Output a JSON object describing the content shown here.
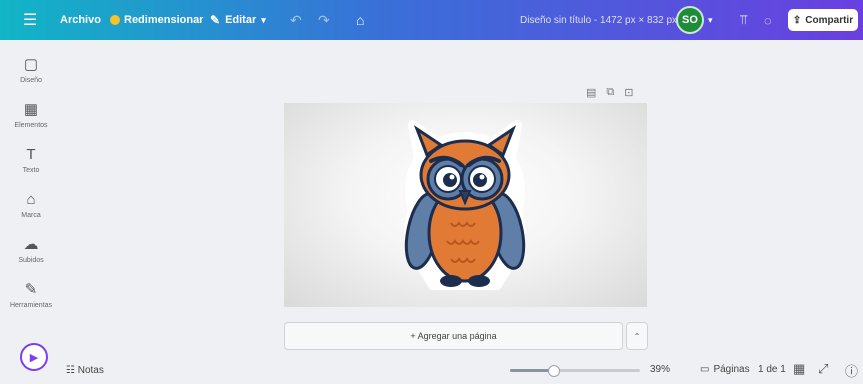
{
  "topbar": {
    "menu_icon": "menu-icon",
    "archivo": "Archivo",
    "redimensionar": "Redimensionar",
    "editar": "Editar",
    "doc_title": "Diseño sin título - 1472 px × 832 px",
    "avatar_initials": "SO",
    "share_label": "Compartir"
  },
  "sidebar": {
    "items": [
      {
        "label": "Diseño",
        "icon": "layout-icon"
      },
      {
        "label": "Elementos",
        "icon": "elements-icon"
      },
      {
        "label": "Texto",
        "icon": "text-icon"
      },
      {
        "label": "Marca",
        "icon": "brand-icon"
      },
      {
        "label": "Subidos",
        "icon": "upload-icon"
      },
      {
        "label": "Herramientas",
        "icon": "tools-icon"
      }
    ]
  },
  "canvas": {
    "add_page_label": "+ Agregar una página"
  },
  "bottombar": {
    "notes_label": "Notas",
    "zoom": "39%",
    "zoom_fraction": 0.33,
    "pages_label": "Páginas",
    "page_count": "1 de 1"
  },
  "colors": {
    "accent": "#7d3ef0",
    "topbar_start": "#11b5c6",
    "topbar_end": "#6a3fe0",
    "owl_orange": "#e07a35",
    "owl_blue": "#5f7fa8",
    "owl_navy": "#1c2d4d"
  }
}
